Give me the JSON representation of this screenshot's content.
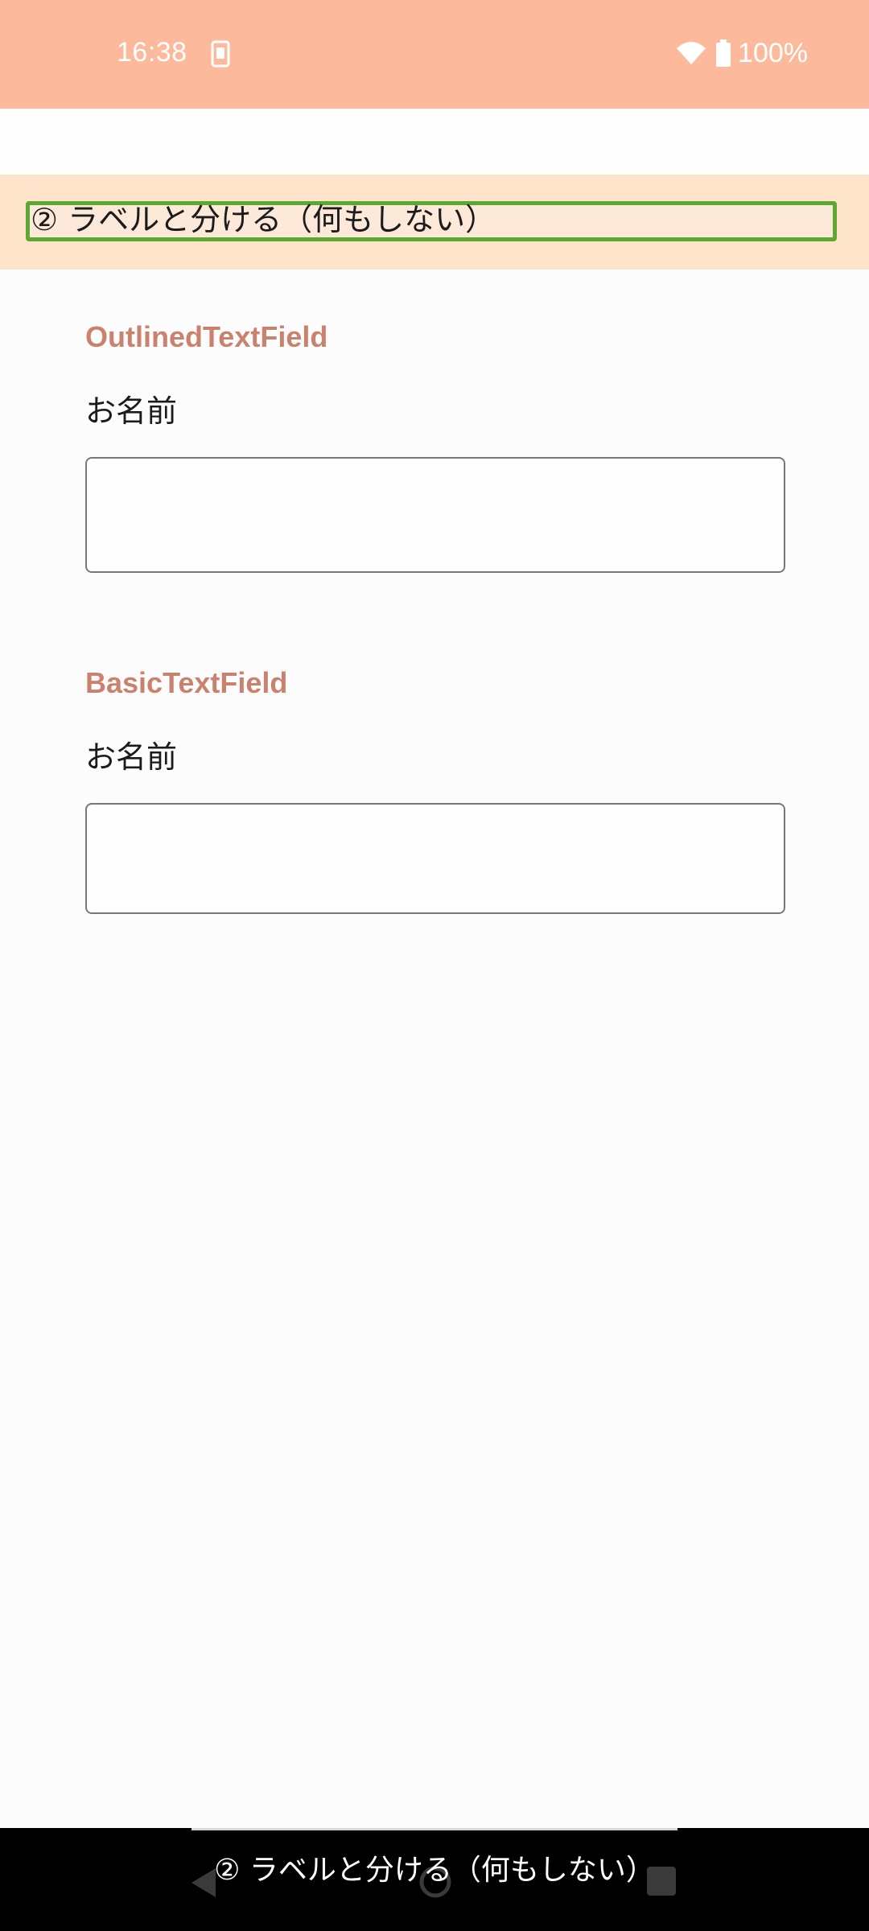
{
  "status_bar": {
    "time": "16:38",
    "battery": "100%",
    "notification_icon": "screenshot-icon",
    "wifi_icon": "wifi-icon",
    "battery_icon": "battery-icon",
    "background_color": "#fdb99c"
  },
  "header": {
    "title": "② ラベルと分ける（何もしない）",
    "background_color": "#ffe4cc",
    "highlight_color": "#5ba832"
  },
  "sections": [
    {
      "title": "OutlinedTextField",
      "label": "お名前",
      "value": ""
    },
    {
      "title": "BasicTextField",
      "label": "お名前",
      "value": ""
    }
  ],
  "accent_color": "#c9826d",
  "nav_bar": {
    "caption": "② ラベルと分ける（何もしない）",
    "back_icon": "back-icon",
    "home_icon": "home-icon",
    "recents_icon": "recents-icon"
  }
}
